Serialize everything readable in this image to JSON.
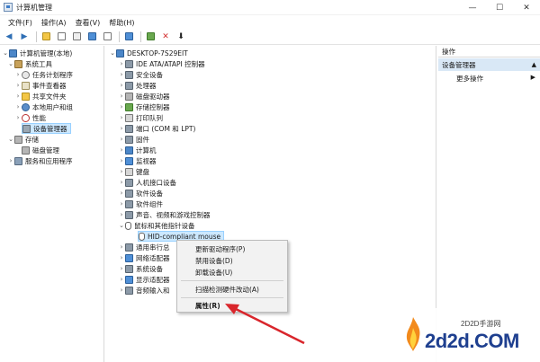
{
  "window": {
    "title": "计算机管理",
    "controls": {
      "minimize": "—",
      "maximize": "☐",
      "close": "✕"
    }
  },
  "menu": [
    "文件(F)",
    "操作(A)",
    "查看(V)",
    "帮助(H)"
  ],
  "toolbar": {
    "icons": [
      "back-icon",
      "forward-icon",
      "up-folder-icon",
      "show-hide-tree-icon",
      "properties-icon",
      "help-icon",
      "action-pane-icon",
      "monitor-icon",
      "scan-hardware-icon",
      "uninstall-icon",
      "update-driver-icon"
    ]
  },
  "left_tree": {
    "root": "计算机管理(本地)",
    "system_tools": "系统工具",
    "items": [
      "任务计划程序",
      "事件查看器",
      "共享文件夹",
      "本地用户和组",
      "性能",
      "设备管理器"
    ],
    "storage": "存储",
    "disk_management": "磁盘管理",
    "services": "服务和应用程序"
  },
  "device_tree": {
    "computer": "DESKTOP-7S29EIT",
    "categories": [
      "IDE ATA/ATAPI 控制器",
      "安全设备",
      "处理器",
      "磁盘驱动器",
      "存储控制器",
      "打印队列",
      "端口 (COM 和 LPT)",
      "固件",
      "计算机",
      "监视器",
      "键盘",
      "人机接口设备",
      "软件设备",
      "软件组件",
      "声音、视频和游戏控制器",
      "鼠标和其他指针设备"
    ],
    "selected_device": "HID-compliant mouse",
    "after_categories": [
      "通用串行总",
      "网络适配器",
      "系统设备",
      "显示适配器",
      "音频输入和"
    ]
  },
  "context_menu": {
    "items": [
      "更新驱动程序(P)",
      "禁用设备(D)",
      "卸载设备(U)",
      "扫描检测硬件改动(A)",
      "属性(R)"
    ]
  },
  "actions_pane": {
    "header": "操作",
    "group": "设备管理器",
    "more": "更多操作"
  },
  "watermark": {
    "small": "2D2D手游网",
    "big": "2d2d.COM"
  },
  "colors": {
    "selection": "#cce8ff",
    "actions_group_bg": "#d9e8f6",
    "arrow": "#d9262c",
    "watermark_text": "#1e3f8f"
  }
}
